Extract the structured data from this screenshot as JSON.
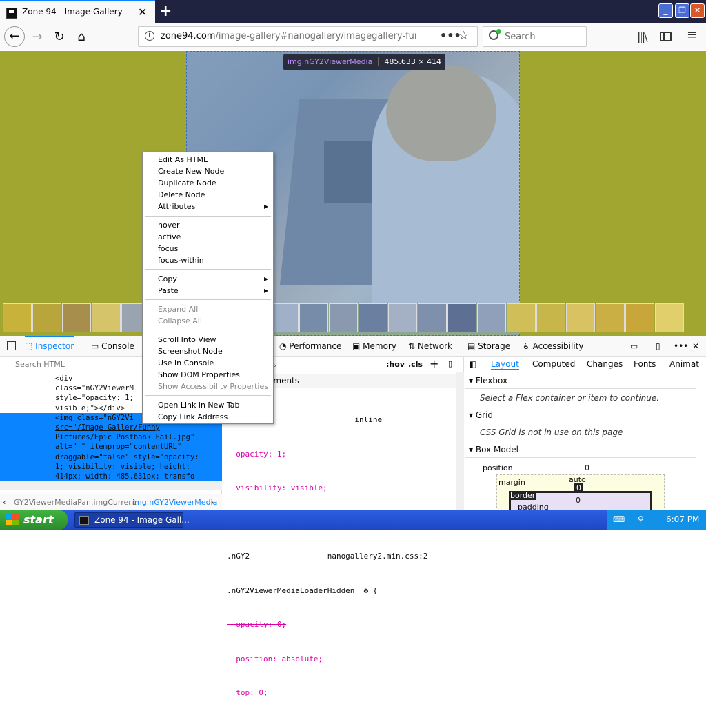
{
  "browser": {
    "tab_title": "Zone 94 - Image Gallery",
    "tab_close": "✕",
    "new_tab": "+",
    "window_min": "_",
    "window_max": "❐",
    "window_close": "✕",
    "url": "zone94.com/image-gallery#nanogallery/imagegallery-funnypictu",
    "url_domain": "zone94.com",
    "url_path": "/image-gallery#nanogallery/imagegallery-funnypictu",
    "page_actions": "•••",
    "bookmark_star": "☆",
    "search_placeholder": "Search",
    "library_icon": "|||\\",
    "menu_icon": "≡"
  },
  "page": {
    "highlight_badge_selector": "img.nGY2ViewerMedia",
    "highlight_badge_size": "485.633 × 414",
    "background_color": "#a1a630",
    "thumbnail_count": 23
  },
  "context_menu": {
    "group1": [
      "Edit As HTML",
      "Create New Node",
      "Duplicate Node",
      "Delete Node",
      "Attributes"
    ],
    "group2": [
      "hover",
      "active",
      "focus",
      "focus-within"
    ],
    "group3": [
      "Copy",
      "Paste"
    ],
    "group4": [
      "Expand All",
      "Collapse All"
    ],
    "group5": [
      "Scroll Into View",
      "Screenshot Node",
      "Use in Console",
      "Show DOM Properties",
      "Show Accessibility Properties"
    ],
    "group6": [
      "Open Link in New Tab",
      "Copy Link Address"
    ]
  },
  "devtools": {
    "tabs": {
      "inspector": "Inspector",
      "console": "Console",
      "performance": "Performance",
      "memory": "Memory",
      "network": "Network",
      "storage": "Storage",
      "accessibility": "Accessibility"
    },
    "search_placeholder": "Search HTML",
    "markup_lines": [
      "<div",
      "class=\"nGY2ViewerM",
      "style=\"opacity: 1;",
      "visible;\"></div>"
    ],
    "selected_lines": [
      "<img class=\"nGY2Vi",
      "src=\"/Image Galler/Funny",
      "Pictures/Epic Postbank Fail.jpg\"",
      "alt=\" \" itemprop=\"contentURL\"",
      "draggable=\"false\" style=\"opacity:",
      "1; visibility: visible; height:",
      "414px; width: 485.631px; transfo"
    ],
    "breadcrumb": [
      "GY2ViewerMediaPan.imgCurrent",
      "img.nGY2ViewerMedia"
    ],
    "rules_header_filter": "s",
    "rules_hov": ":hov",
    "rules_cls": ".cls",
    "rules_section": "ements",
    "rules_code_lines": [
      "  {                         inline",
      "  opacity: 1;",
      "  visibility: visible;",
      "}",
      ".nGY2                 nanogallery2.min.css:2",
      ".nGY2ViewerMediaLoaderHidden  ⚙ {",
      "  opacity: 0;",
      "  position: absolute;",
      "  top: 0;"
    ],
    "layout_tabs": [
      "Layout",
      "Computed",
      "Changes",
      "Fonts",
      "Animat"
    ],
    "flexbox_title": "Flexbox",
    "flexbox_msg": "Select a Flex container or item to continue.",
    "grid_title": "Grid",
    "grid_msg": "CSS Grid is not in use on this page",
    "boxmodel_title": "Box Model",
    "position_label": "position",
    "position_value": "0",
    "margin_label": "margin",
    "margin_value": "auto",
    "border_label": "border",
    "border_value": "0",
    "padding_label": "padding",
    "padding_value": "0"
  },
  "taskbar": {
    "start_label": "start",
    "task_item": "Zone 94 - Image Gall...",
    "clock": "6:07 PM"
  }
}
